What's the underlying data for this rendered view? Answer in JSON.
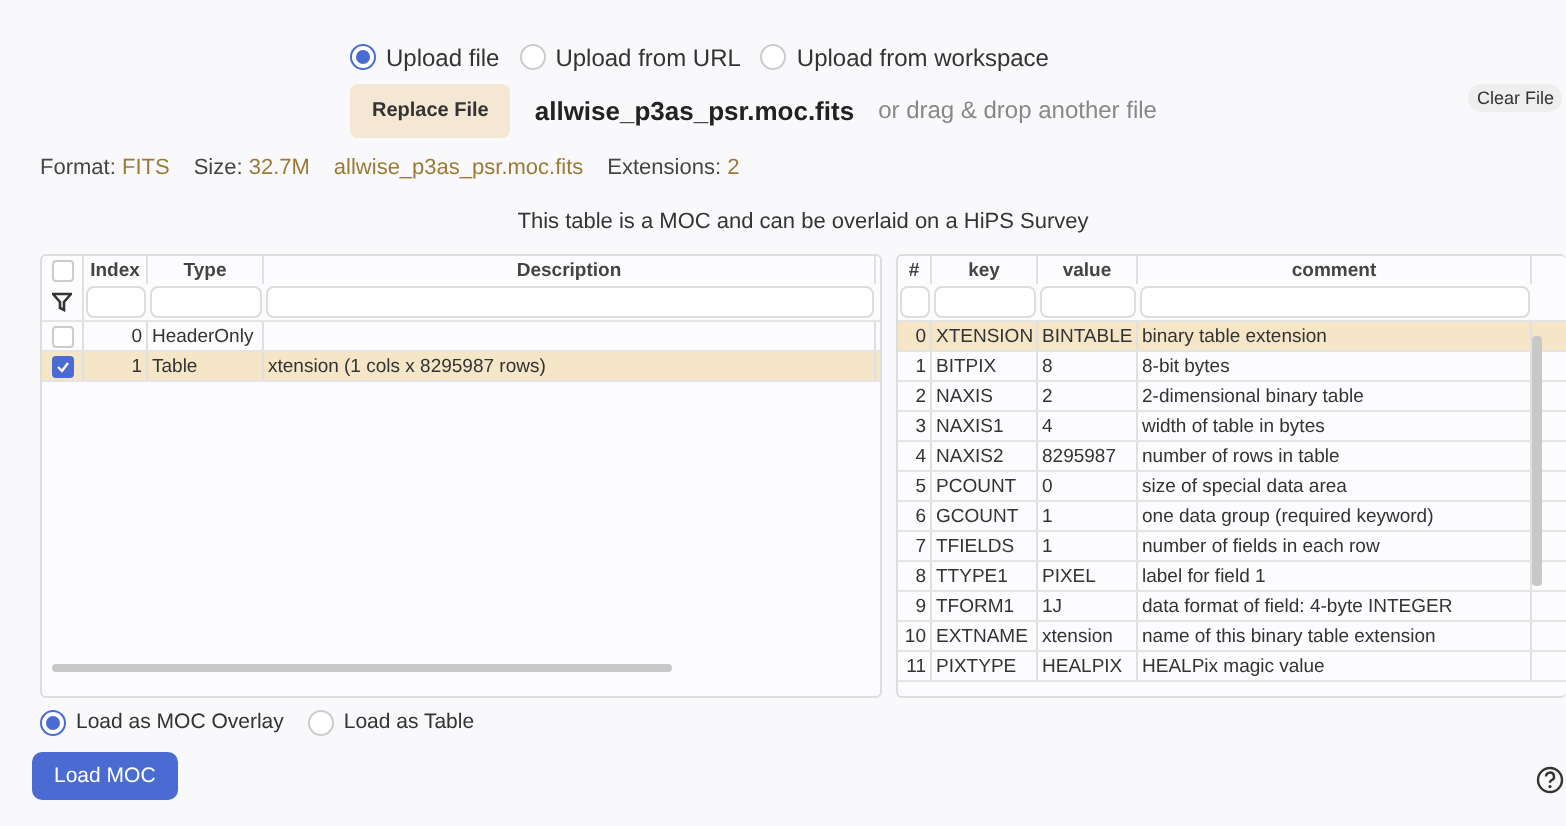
{
  "upload_options": [
    {
      "label": "Upload file",
      "selected": true
    },
    {
      "label": "Upload from URL",
      "selected": false
    },
    {
      "label": "Upload from workspace",
      "selected": false
    }
  ],
  "file": {
    "button": "Replace File",
    "name": "allwise_p3as_psr.moc.fits",
    "hint": "or drag & drop another file",
    "clear_button": "Clear File"
  },
  "info": [
    {
      "label": "Format:",
      "value": "FITS"
    },
    {
      "label": "Size:",
      "value": "32.7M"
    },
    {
      "value": "allwise_p3as_psr.moc.fits"
    },
    {
      "label": "Extensions:",
      "value": "2"
    }
  ],
  "notice": "This table is a MOC and can be overlaid on a HiPS Survey",
  "hdu_table": {
    "all_checked": false,
    "columns": [
      "Index",
      "Type",
      "Description"
    ],
    "rows": [
      {
        "checked": false,
        "selected": false,
        "cells": [
          "0",
          "HeaderOnly"
        ]
      },
      {
        "checked": true,
        "selected": true,
        "cells": [
          "1",
          "Table",
          "xtension (1 cols x 8295987 rows)"
        ]
      }
    ]
  },
  "header_table": {
    "columns": [
      "#",
      "key",
      "value",
      "comment"
    ],
    "rows": [
      {
        "selected": true,
        "cells": [
          "0",
          "XTENSION",
          "BINTABLE",
          "binary table extension"
        ]
      },
      {
        "selected": false,
        "cells": [
          "1",
          "BITPIX",
          "8",
          "8-bit bytes"
        ]
      },
      {
        "selected": false,
        "cells": [
          "2",
          "NAXIS",
          "2",
          "2-dimensional binary table"
        ]
      },
      {
        "selected": false,
        "cells": [
          "3",
          "NAXIS1",
          "4",
          "width of table in bytes"
        ]
      },
      {
        "selected": false,
        "cells": [
          "4",
          "NAXIS2",
          "8295987",
          "number of rows in table"
        ]
      },
      {
        "selected": false,
        "cells": [
          "5",
          "PCOUNT",
          "0",
          "size of special data area"
        ]
      },
      {
        "selected": false,
        "cells": [
          "6",
          "GCOUNT",
          "1",
          "one data group (required keyword)"
        ]
      },
      {
        "selected": false,
        "cells": [
          "7",
          "TFIELDS",
          "1",
          "number of fields in each row"
        ]
      },
      {
        "selected": false,
        "cells": [
          "8",
          "TTYPE1",
          "PIXEL",
          "label for field 1"
        ]
      },
      {
        "selected": false,
        "cells": [
          "9",
          "TFORM1",
          "1J",
          "data format of field: 4-byte INTEGER"
        ]
      },
      {
        "selected": false,
        "cells": [
          "10",
          "EXTNAME",
          "xtension",
          "name of this binary table extension"
        ]
      },
      {
        "selected": false,
        "cells": [
          "11",
          "PIXTYPE",
          "HEALPIX",
          "HEALPix magic value"
        ]
      }
    ]
  },
  "load_options": [
    {
      "label": "Load as MOC Overlay",
      "selected": true
    },
    {
      "label": "Load as Table",
      "selected": false
    }
  ],
  "load_button": "Load MOC"
}
